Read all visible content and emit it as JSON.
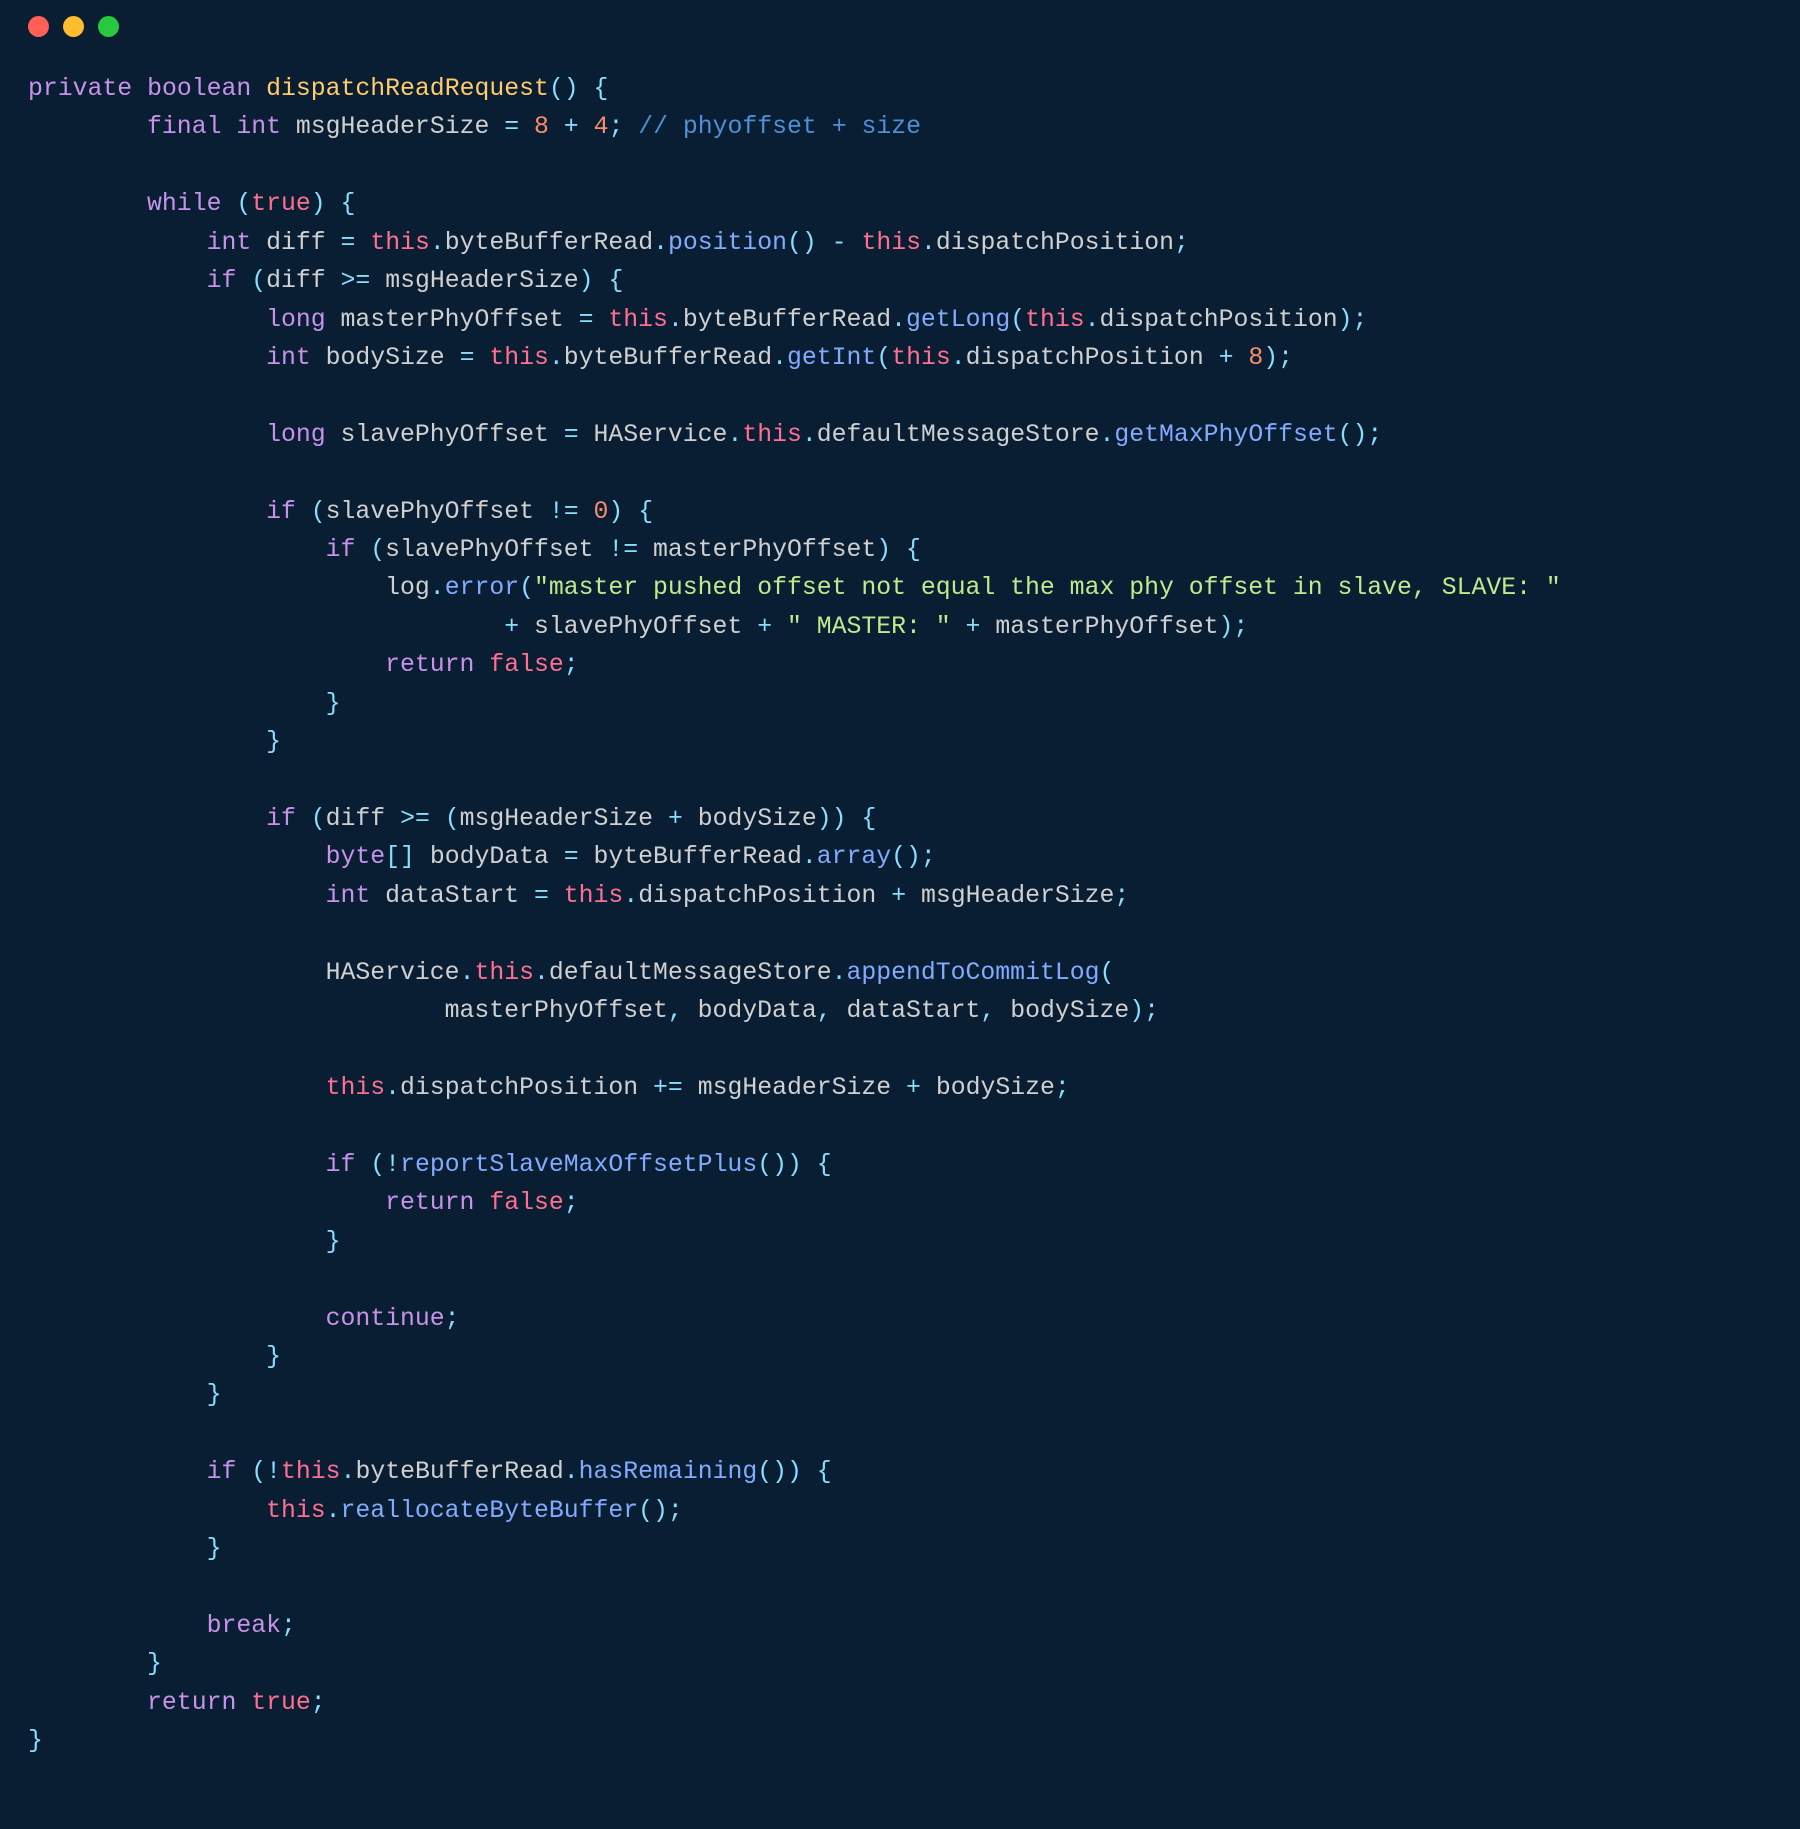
{
  "code": {
    "t": {
      "private": "private",
      "boolean": "boolean",
      "final": "final",
      "int": "int",
      "long": "long",
      "while": "while",
      "true": "true",
      "false": "false",
      "if": "if",
      "return": "return",
      "break": "break",
      "continue": "continue",
      "byte": "byte",
      "this": "this"
    },
    "method_name": "dispatchReadRequest",
    "vars": {
      "msgHeaderSize": "msgHeaderSize",
      "diff": "diff",
      "byteBufferRead": "byteBufferRead",
      "dispatchPosition": "dispatchPosition",
      "masterPhyOffset": "masterPhyOffset",
      "bodySize": "bodySize",
      "slavePhyOffset": "slavePhyOffset",
      "HAService": "HAService",
      "defaultMessageStore": "defaultMessageStore",
      "log": "log",
      "bodyData": "bodyData",
      "dataStart": "dataStart"
    },
    "calls": {
      "position": "position",
      "getLong": "getLong",
      "getInt": "getInt",
      "getMaxPhyOffset": "getMaxPhyOffset",
      "error": "error",
      "array": "array",
      "appendToCommitLog": "appendToCommitLog",
      "reportSlaveMaxOffsetPlus": "reportSlaveMaxOffsetPlus",
      "hasRemaining": "hasRemaining",
      "reallocateByteBuffer": "reallocateByteBuffer"
    },
    "nums": {
      "n8": "8",
      "n4": "4",
      "n0": "0"
    },
    "strings": {
      "err1": "\"master pushed offset not equal the max phy offset in slave, SLAVE: \"",
      "err2": "\" MASTER: \""
    },
    "comment_phyoffset": "// phyoffset + size"
  }
}
